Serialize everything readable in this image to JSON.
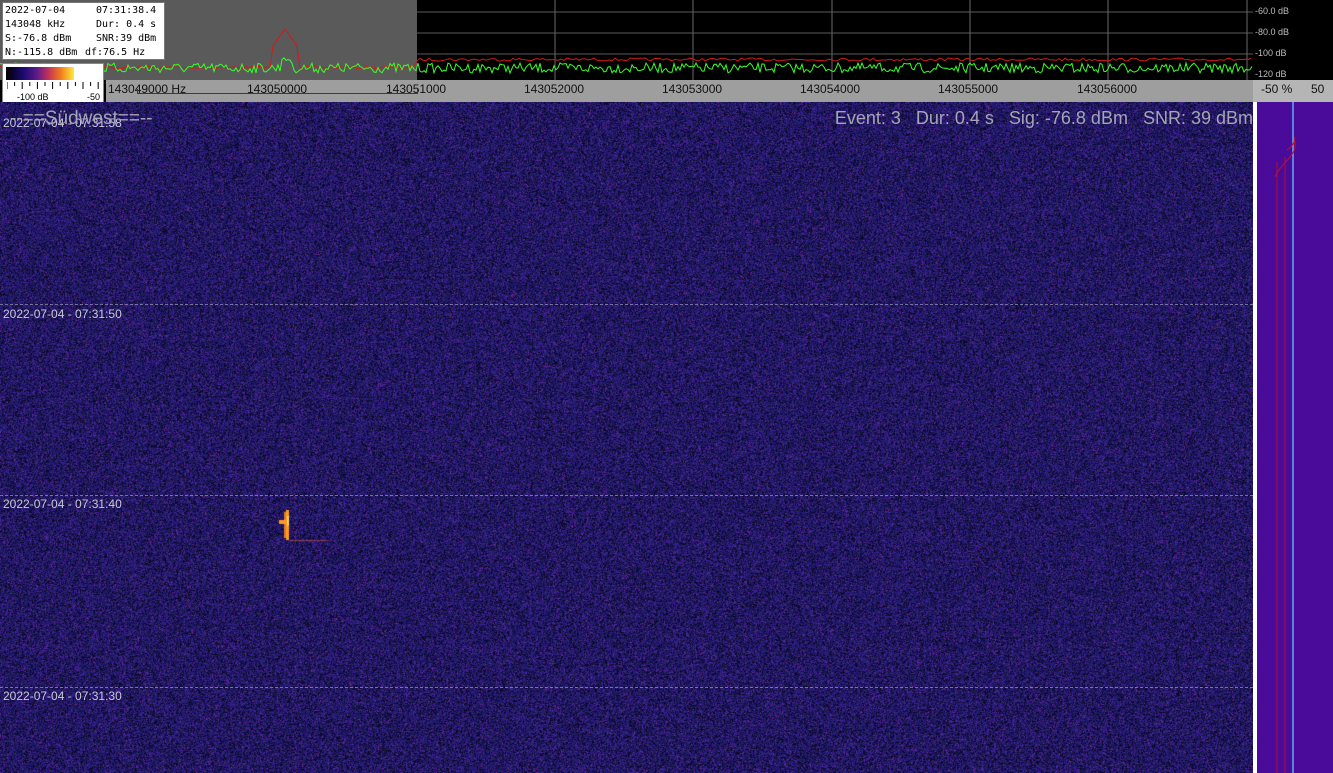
{
  "info": {
    "date": "2022-07-04",
    "time": "07:31:38.4",
    "freq": "143048 kHz",
    "dur": "Dur: 0.4 s",
    "signal": "S:-76.8 dBm",
    "snr": "SNR:39 dBm",
    "noise": "N:-115.8 dBm",
    "df": "df:76.5 Hz"
  },
  "colorbar": {
    "min_label": "-100 dB",
    "max_label": "-50"
  },
  "db_scale": [
    "-60.0 dB",
    "-80.0 dB",
    "-100 dB",
    "-120 dB"
  ],
  "freq_axis": {
    "labels": [
      "143049000 Hz",
      "143050000",
      "143051000",
      "143052000",
      "143053000",
      "143054000",
      "143055000",
      "143056000"
    ]
  },
  "percent_axis": {
    "left": "-50 %",
    "right": "50"
  },
  "waterfall": {
    "title": "--==Südwest==--",
    "stats": "Event: 3   Dur: 0.4 s   Sig: -76.8 dBm   SNR: 39 dBm",
    "timestamps": [
      "2022-07-04 - 07:31:58",
      "2022-07-04 - 07:31:50",
      "2022-07-04 - 07:31:40",
      "2022-07-04 - 07:31:30"
    ]
  },
  "colors": {
    "background": "#191755",
    "trace_green": "#39ff2a",
    "trace_red": "#d11a1a",
    "marker_blue": "#1a2fd0",
    "side_panel": "#4a0a9a",
    "signal": "#ff9a1e"
  }
}
